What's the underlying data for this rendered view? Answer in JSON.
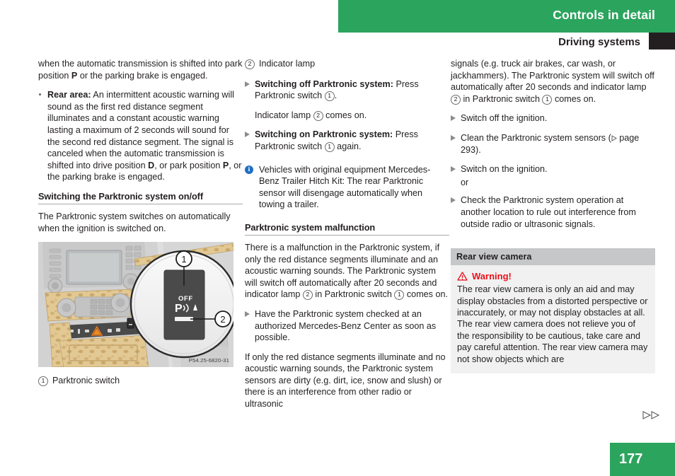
{
  "header": {
    "chapter": "Controls in detail",
    "section": "Driving systems",
    "green": "#2ba45d",
    "black": "#231f20"
  },
  "footer": {
    "page_number": "177",
    "arrows_icon": "double-right-triangle-icon"
  },
  "left_column": {
    "para_continued": {
      "before_p": "when the automatic transmission is shifted into park position ",
      "p": "P",
      "after_p": " or the parking brake is engaged."
    },
    "rear_area": {
      "label": "Rear area:",
      "text_1": " An intermittent acoustic warning will sound as the first red distance segment illuminates and a constant acoustic warning lasting a maximum of 2 seconds will sound for the second red distance segment. The signal is canceled when the automatic transmission is shifted into drive position ",
      "d": "D",
      "text_2": ", or park position ",
      "p": "P",
      "text_3": ", or the parking brake is engaged."
    },
    "section_heading": "Switching the Parktronic system on/off",
    "section_body": "The Parktronic system switches on automatically when the ignition is switched on.",
    "figure": {
      "name": "parktronic-switch-illustration",
      "code": "P54.25-6820-31",
      "callout_1": "1",
      "callout_2": "2",
      "switch_off_label": "OFF",
      "switch_symbol": "P"
    },
    "legend": {
      "number": "1",
      "text": "Parktronic switch"
    }
  },
  "middle_column": {
    "legend_2": {
      "number": "2",
      "text": "Indicator lamp"
    },
    "step_off": {
      "label": "Switching off Parktronic system:",
      "text_1": " Press Parktronic switch ",
      "ref": "1",
      "text_2": "."
    },
    "step_off_result": {
      "text_1": "Indicator lamp ",
      "ref": "2",
      "text_2": " comes on."
    },
    "step_on": {
      "label": "Switching on Parktronic system:",
      "text_1": " Press Parktronic switch ",
      "ref": "1",
      "text_2": " again."
    },
    "info_note": "Vehicles with original equipment Mercedes-Benz Trailer Hitch Kit: The rear Parktronic sensor will disengage automatically when towing a trailer.",
    "info_icon": "info-circle-icon",
    "section_heading": "Parktronic system malfunction",
    "malfunction_para": {
      "text_1": "There is a malfunction in the Parktronic system, if only the red distance segments illuminate and an acoustic warning sounds. The Parktronic system will switch off automatically after 20 seconds and indicator lamp ",
      "ref_a": "2",
      "text_2": " in Parktronic switch ",
      "ref_b": "1",
      "text_3": " comes on."
    },
    "step_check": "Have the Parktronic system checked at an authorized Mercedes-Benz Center as soon as possible.",
    "dirty_para": "If only the red distance segments illuminate and no acoustic warning sounds, the Parktronic system sensors are dirty (e.g. dirt, ice, snow and slush) or there is an interference from other radio or ultrasonic"
  },
  "right_column": {
    "continued_para": {
      "text_1": "signals (e.g. truck air brakes, car wash, or jackhammers). The Parktronic system will switch off automatically after 20 seconds and indicator lamp ",
      "ref_a": "2",
      "text_2": " in Parktronic switch ",
      "ref_b": "1",
      "text_3": " comes on."
    },
    "step_ignition_off": "Switch off the ignition.",
    "step_clean": {
      "text_1": "Clean the Parktronic system sensors (",
      "page_ref_icon": "page-reference-triangle-icon",
      "text_2": " page 293)."
    },
    "step_ignition_on": "Switch on the ignition.",
    "or_word": "or",
    "step_check_other": "Check the Parktronic system operation at another location to rule out interference from outside radio or ultrasonic signals.",
    "box": {
      "title": "Rear view camera",
      "warning_icon": "warning-triangle-icon",
      "warning_label": "Warning!",
      "warning_color": "#e8121b",
      "body": "The rear view camera is only an aid and may display obstacles from a distorted perspective or inaccurately, or may not display obstacles at all. The rear view camera does not relieve you of the responsibility to be cautious, take care and pay careful attention. The rear view camera may not show objects which are"
    }
  }
}
